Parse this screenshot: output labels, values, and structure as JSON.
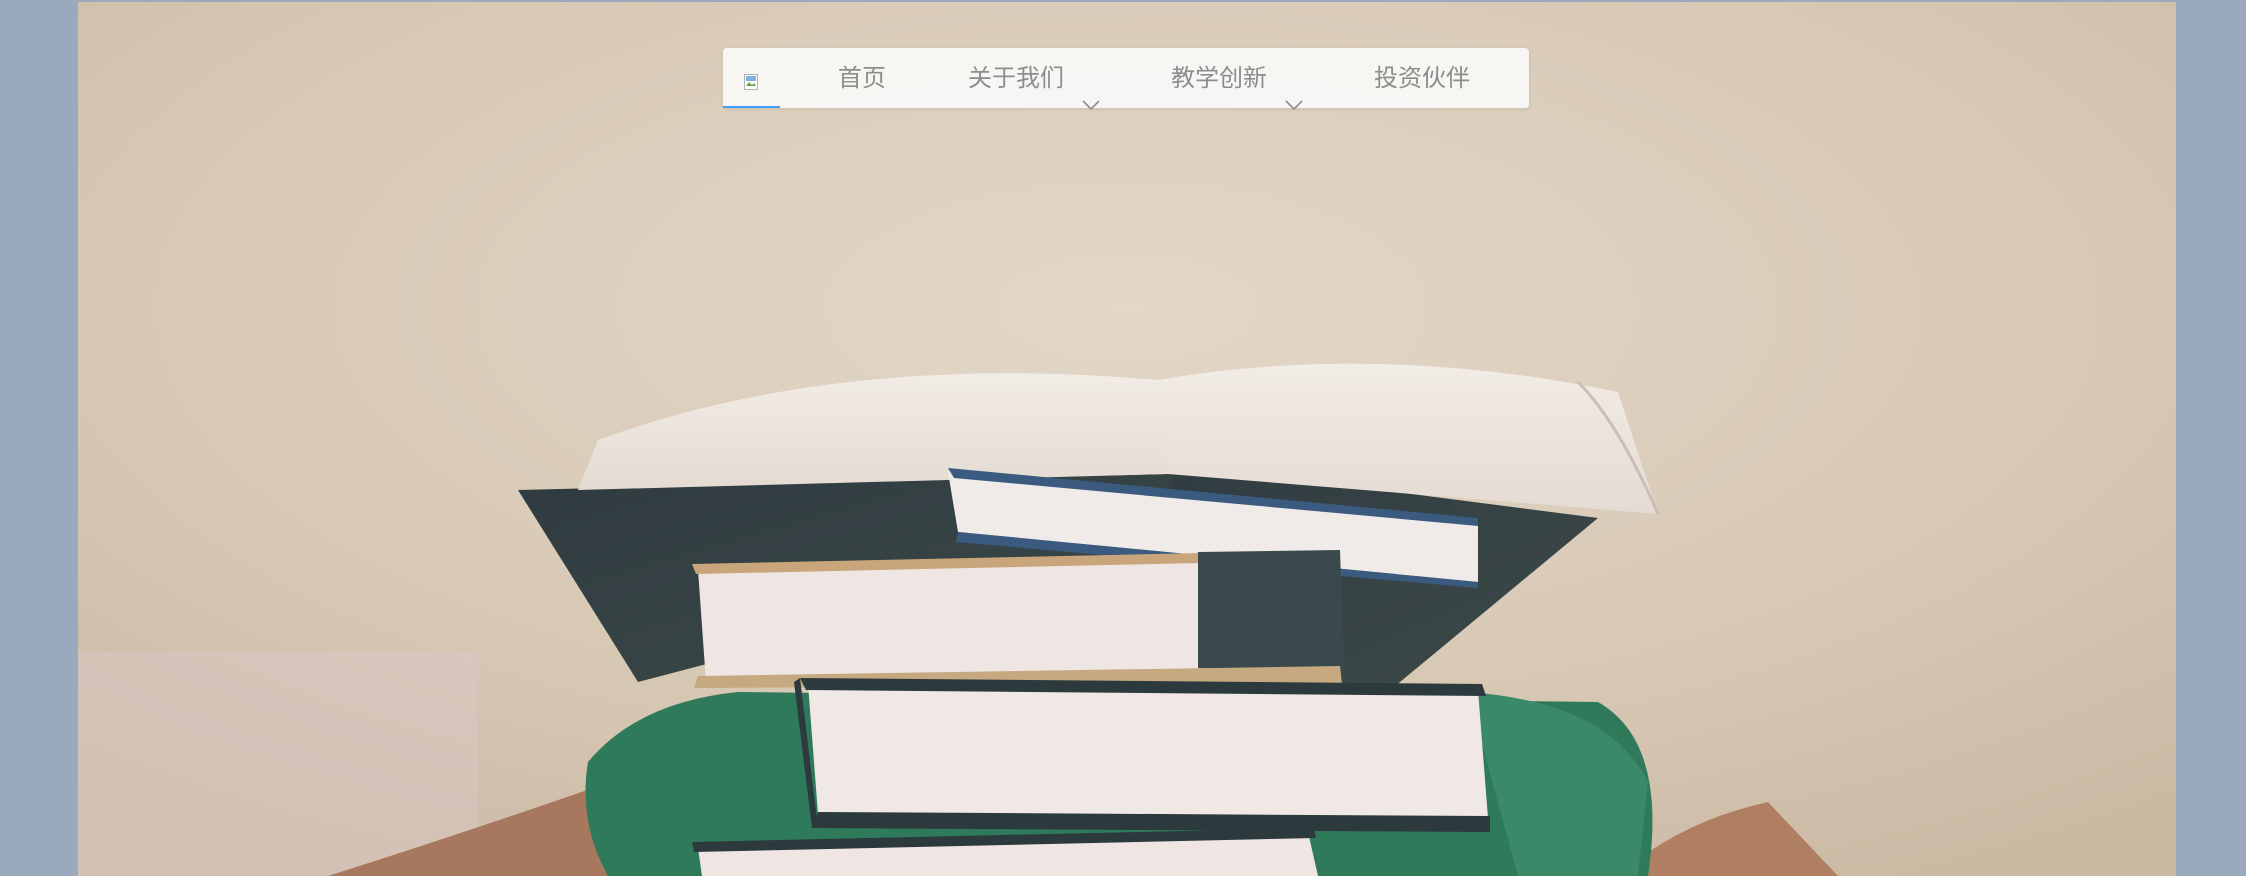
{
  "navbar": {
    "logo_alt": "",
    "items": [
      {
        "label": "首页",
        "has_dropdown": false,
        "icon": ""
      },
      {
        "label": "关于我们",
        "has_dropdown": true,
        "icon": "chevron-down-icon"
      },
      {
        "label": "教学创新",
        "has_dropdown": true,
        "icon": "chevron-down-icon"
      },
      {
        "label": "投资伙伴",
        "has_dropdown": false,
        "icon": ""
      }
    ],
    "active_indicator_color": "#409eff",
    "text_color": "#8d8d8d"
  },
  "hero": {
    "image_subject": "stack-of-books-held-by-person",
    "background_color": "#d8c9b6",
    "side_color": "#9ba9bd"
  }
}
